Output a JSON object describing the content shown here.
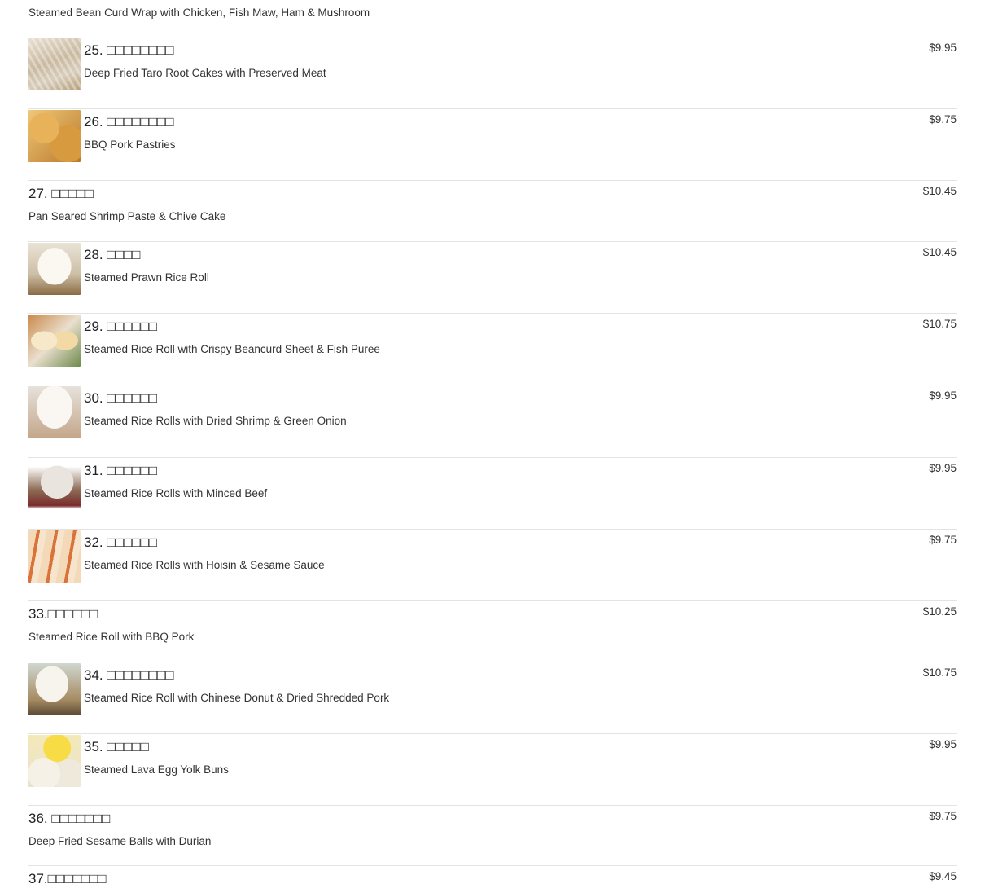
{
  "top_description": "Steamed Bean Curd Wrap with Chicken, Fish Maw, Ham & Mushroom",
  "items": [
    {
      "number": "25.",
      "chinese": "□□□□□□□□",
      "english": "Deep Fried Taro Root Cakes with Preserved Meat",
      "price": "$9.95",
      "image": "taro-cake-image"
    },
    {
      "number": "26.",
      "chinese": "□□□□□□□□",
      "english": "BBQ Pork Pastries",
      "price": "$9.75",
      "image": "bbq-pork-pastries-image"
    },
    {
      "number": "27.",
      "chinese": "□□□□□",
      "english": "Pan Seared Shrimp Paste & Chive Cake",
      "price": "$10.45",
      "image": ""
    },
    {
      "number": "28.",
      "chinese": "□□□□",
      "english": "Steamed Prawn Rice Roll",
      "price": "$10.45",
      "image": "prawn-rice-roll-image"
    },
    {
      "number": "29.",
      "chinese": "□□□□□□",
      "english": "Steamed Rice Roll with Crispy Beancurd Sheet & Fish Puree",
      "price": "$10.75",
      "image": "crispy-rice-roll-image"
    },
    {
      "number": "30.",
      "chinese": "□□□□□□",
      "english": "Steamed Rice Rolls with Dried Shrimp & Green Onion",
      "price": "$9.95",
      "image": "dried-shrimp-rice-roll-image"
    },
    {
      "number": "31.",
      "chinese": "□□□□□□",
      "english": "Steamed Rice Rolls with Minced Beef",
      "price": "$9.95",
      "image": "beef-rice-roll-image"
    },
    {
      "number": "32.",
      "chinese": "□□□□□□",
      "english": "Steamed Rice Rolls with Hoisin & Sesame Sauce",
      "price": "$9.75",
      "image": "hoisin-rice-roll-image"
    },
    {
      "number": "33.",
      "chinese": "□□□□□□",
      "english": "Steamed Rice Roll with BBQ Pork",
      "price": "$10.25",
      "image": ""
    },
    {
      "number": "34.",
      "chinese": "□□□□□□□□",
      "english": "Steamed Rice Roll with Chinese Donut & Dried Shredded Pork",
      "price": "$10.75",
      "image": "donut-rice-roll-image"
    },
    {
      "number": "35.",
      "chinese": "□□□□□",
      "english": "Steamed Lava Egg Yolk Buns",
      "price": "$9.95",
      "image": "lava-bun-image"
    },
    {
      "number": "36.",
      "chinese": "□□□□□□□",
      "english": "Deep Fried Sesame Balls with Durian",
      "price": "$9.75",
      "image": ""
    },
    {
      "number": "37.",
      "chinese": "□□□□□□□",
      "english": "",
      "price": "$9.45",
      "image": ""
    }
  ]
}
